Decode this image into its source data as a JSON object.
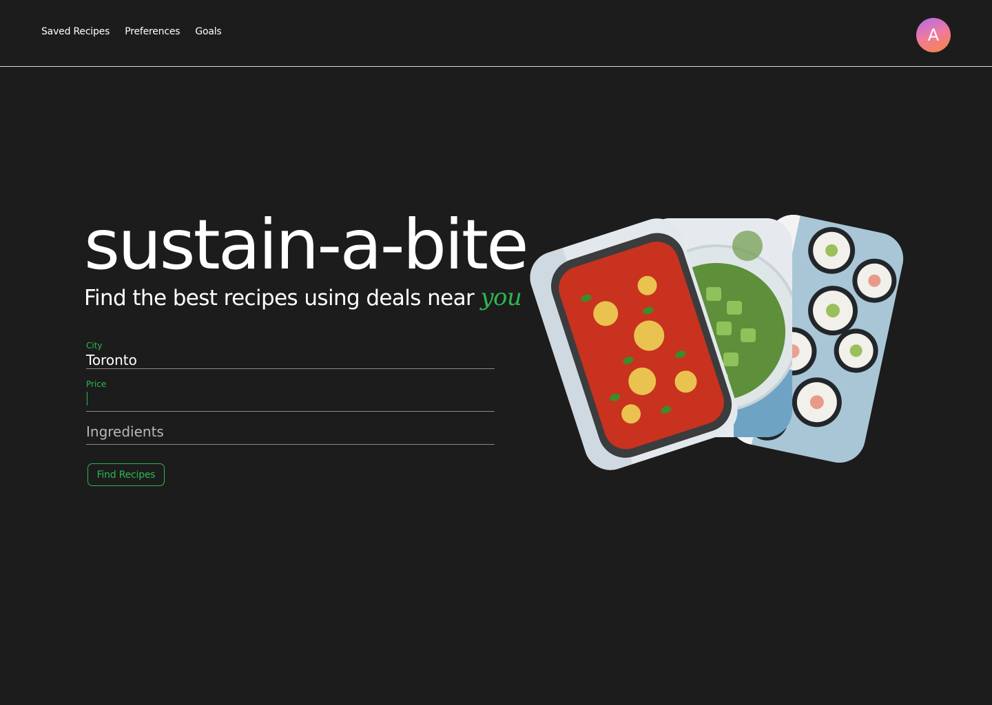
{
  "nav": {
    "items": [
      "Saved Recipes",
      "Preferences",
      "Goals"
    ],
    "avatar_initial": "A"
  },
  "hero": {
    "title": "sustain-a-bite",
    "tagline_main": "Find the best recipes using deals near",
    "tagline_accent": "you"
  },
  "form": {
    "city_label": "City",
    "city_value": "Toronto",
    "price_label": "Price",
    "price_value": "",
    "ingredients_placeholder": "Ingredients",
    "submit_label": "Find Recipes"
  },
  "colors": {
    "background": "#1c1c1c",
    "accent": "#2eb84f",
    "text": "#ffffff"
  },
  "images": [
    {
      "name": "baked-pasta-dish",
      "description": "baked tomato pasta casserole"
    },
    {
      "name": "cucumber-salad",
      "description": "cucumber salad in glass bowl"
    },
    {
      "name": "sushi-rolls",
      "description": "sushi rolls on blue plate"
    }
  ]
}
